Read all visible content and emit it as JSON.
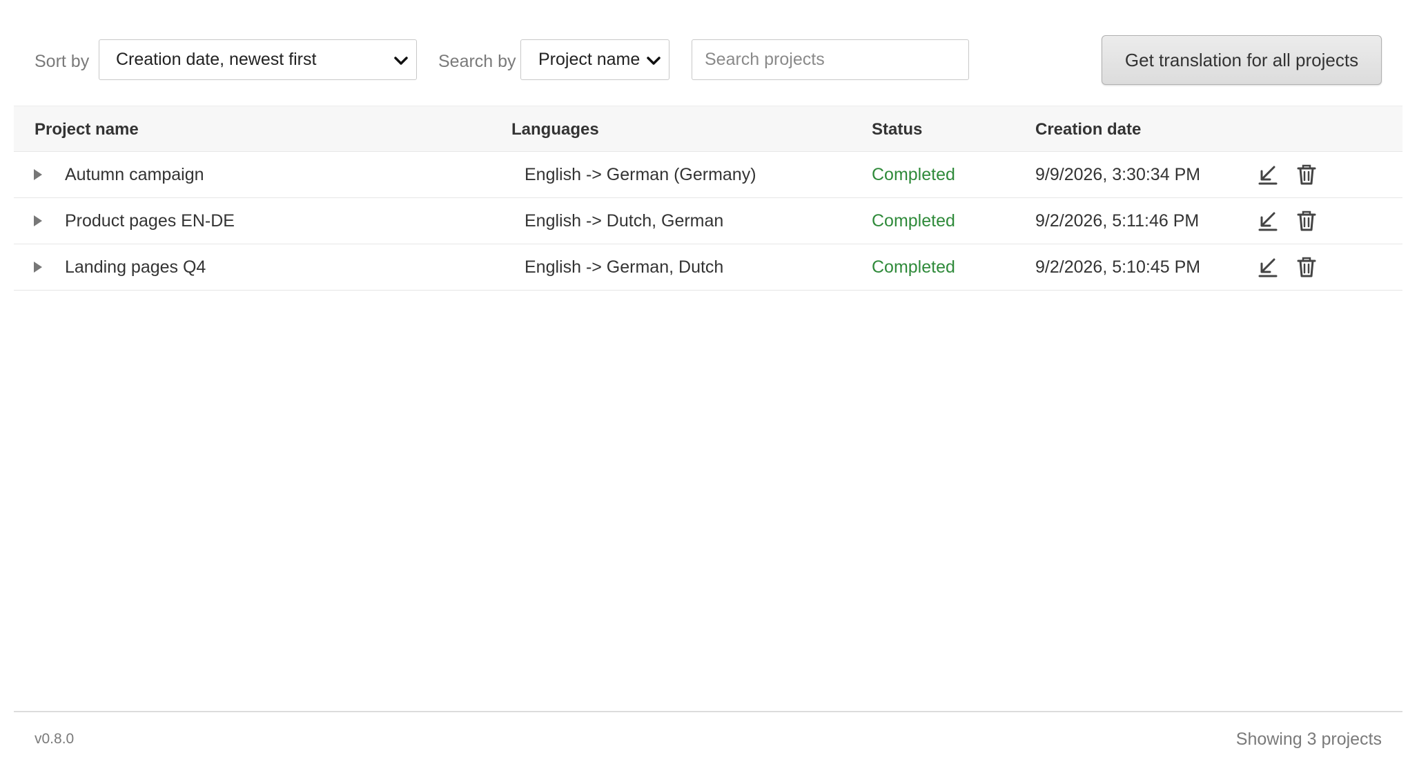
{
  "toolbar": {
    "sort_label": "Sort by",
    "sort_value": "Creation date, newest first",
    "search_by_label": "Search by",
    "search_by_value": "Project name",
    "search_placeholder": "Search projects",
    "get_all_button": "Get translation for all projects"
  },
  "table": {
    "headers": {
      "name": "Project name",
      "languages": "Languages",
      "status": "Status",
      "date": "Creation date"
    },
    "rows": [
      {
        "name": "Autumn campaign",
        "languages": "English -> German (Germany)",
        "status": "Completed",
        "date": "9/9/2026, 3:30:34 PM"
      },
      {
        "name": "Product pages EN-DE",
        "languages": "English -> Dutch, German",
        "status": "Completed",
        "date": "9/2/2026, 5:11:46 PM"
      },
      {
        "name": "Landing pages Q4",
        "languages": "English -> German, Dutch",
        "status": "Completed",
        "date": "9/2/2026, 5:10:45 PM"
      }
    ]
  },
  "footer": {
    "version": "v0.8.0",
    "count": "Showing 3 projects"
  },
  "colors": {
    "status_completed": "#2f8a3a",
    "header_bg": "#f7f7f7"
  },
  "icons": {
    "expander": "triangle-right-icon",
    "download": "download-arrow-icon",
    "delete": "trash-icon",
    "dropdown": "chevron-down-icon"
  }
}
